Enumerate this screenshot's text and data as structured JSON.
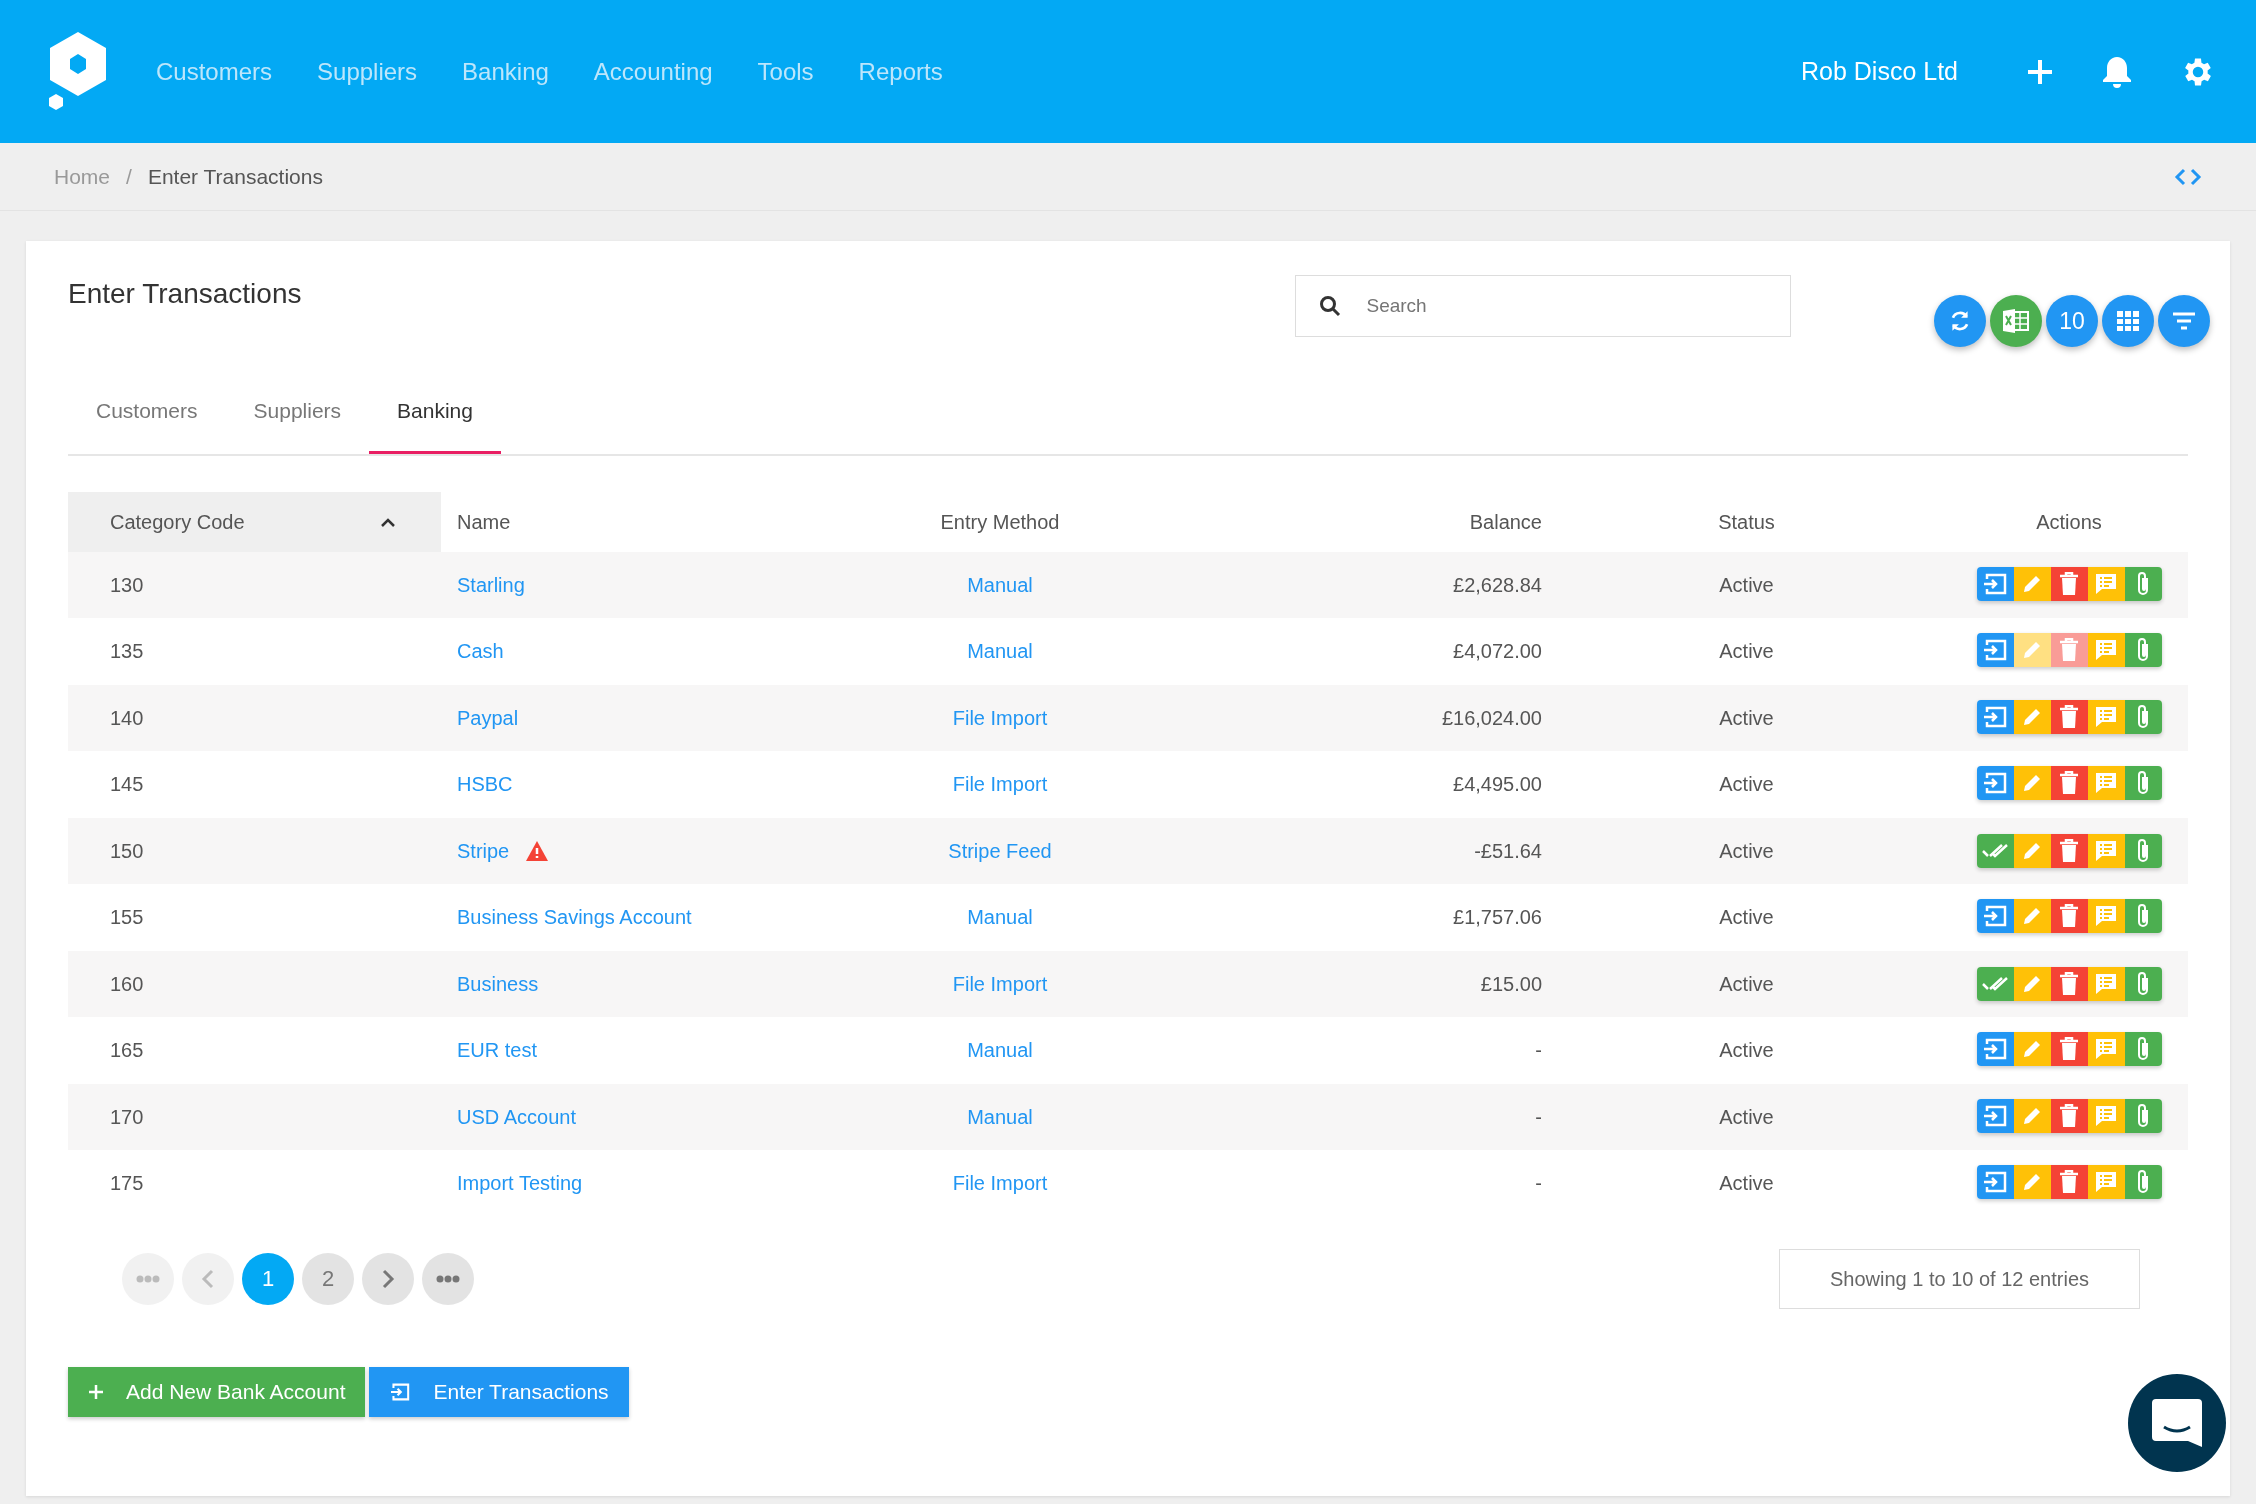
{
  "navbar": {
    "links": [
      {
        "label": "Customers"
      },
      {
        "label": "Suppliers"
      },
      {
        "label": "Banking"
      },
      {
        "label": "Accounting"
      },
      {
        "label": "Tools"
      },
      {
        "label": "Reports"
      }
    ],
    "company": "Rob Disco Ltd"
  },
  "breadcrumb": {
    "separator": "/",
    "items": [
      {
        "label": "Home",
        "current": false
      },
      {
        "label": "Enter Transactions",
        "current": true
      }
    ]
  },
  "page": {
    "title": "Enter Transactions",
    "search": {
      "placeholder": "Search"
    },
    "page_size": "10"
  },
  "tabs": [
    {
      "label": "Customers",
      "selected": false
    },
    {
      "label": "Suppliers",
      "selected": false
    },
    {
      "label": "Banking",
      "selected": true
    }
  ],
  "table": {
    "columns": [
      "Category Code",
      "Name",
      "Entry Method",
      "Balance",
      "Status",
      "Actions"
    ],
    "rows": [
      {
        "code": "130",
        "name": "Starling",
        "warning": false,
        "entry_method": "Manual",
        "balance": "£2,628.84",
        "status": "Active",
        "first_action": {
          "kind": "enter"
        },
        "locked": false
      },
      {
        "code": "135",
        "name": "Cash",
        "warning": false,
        "entry_method": "Manual",
        "balance": "£4,072.00",
        "status": "Active",
        "first_action": {
          "kind": "enter"
        },
        "locked": true
      },
      {
        "code": "140",
        "name": "Paypal",
        "warning": false,
        "entry_method": "File Import",
        "balance": "£16,024.00",
        "status": "Active",
        "first_action": {
          "kind": "enter"
        },
        "locked": false
      },
      {
        "code": "145",
        "name": "HSBC",
        "warning": false,
        "entry_method": "File Import",
        "balance": "£4,495.00",
        "status": "Active",
        "first_action": {
          "kind": "enter"
        },
        "locked": false
      },
      {
        "code": "150",
        "name": "Stripe",
        "warning": true,
        "entry_method": "Stripe Feed",
        "balance": "-£51.64",
        "status": "Active",
        "first_action": {
          "kind": "reconciled"
        },
        "locked": false
      },
      {
        "code": "155",
        "name": "Business Savings Account",
        "warning": false,
        "entry_method": "Manual",
        "balance": "£1,757.06",
        "status": "Active",
        "first_action": {
          "kind": "enter"
        },
        "locked": false
      },
      {
        "code": "160",
        "name": "Business",
        "warning": false,
        "entry_method": "File Import",
        "balance": "£15.00",
        "status": "Active",
        "first_action": {
          "kind": "reconciled"
        },
        "locked": false
      },
      {
        "code": "165",
        "name": "EUR test",
        "warning": false,
        "entry_method": "Manual",
        "balance": "-",
        "status": "Active",
        "first_action": {
          "kind": "enter"
        },
        "locked": false
      },
      {
        "code": "170",
        "name": "USD Account",
        "warning": false,
        "entry_method": "Manual",
        "balance": "-",
        "status": "Active",
        "first_action": {
          "kind": "enter"
        },
        "locked": false
      },
      {
        "code": "175",
        "name": "Import Testing",
        "warning": false,
        "entry_method": "File Import",
        "balance": "-",
        "status": "Active",
        "first_action": {
          "kind": "enter"
        },
        "locked": false
      }
    ]
  },
  "pagination": [
    {
      "kind": "first",
      "disabled": true
    },
    {
      "kind": "prev",
      "disabled": true
    },
    {
      "kind": "page",
      "label": "1",
      "selected": true
    },
    {
      "kind": "page",
      "label": "2",
      "selected": false
    },
    {
      "kind": "next",
      "disabled": false
    },
    {
      "kind": "last",
      "disabled": false
    }
  ],
  "entries_info": "Showing 1 to 10 of 12 entries",
  "buttons": [
    {
      "kind": "add",
      "label": "Add New Bank Account"
    },
    {
      "kind": "enter",
      "label": "Enter Transactions"
    }
  ]
}
